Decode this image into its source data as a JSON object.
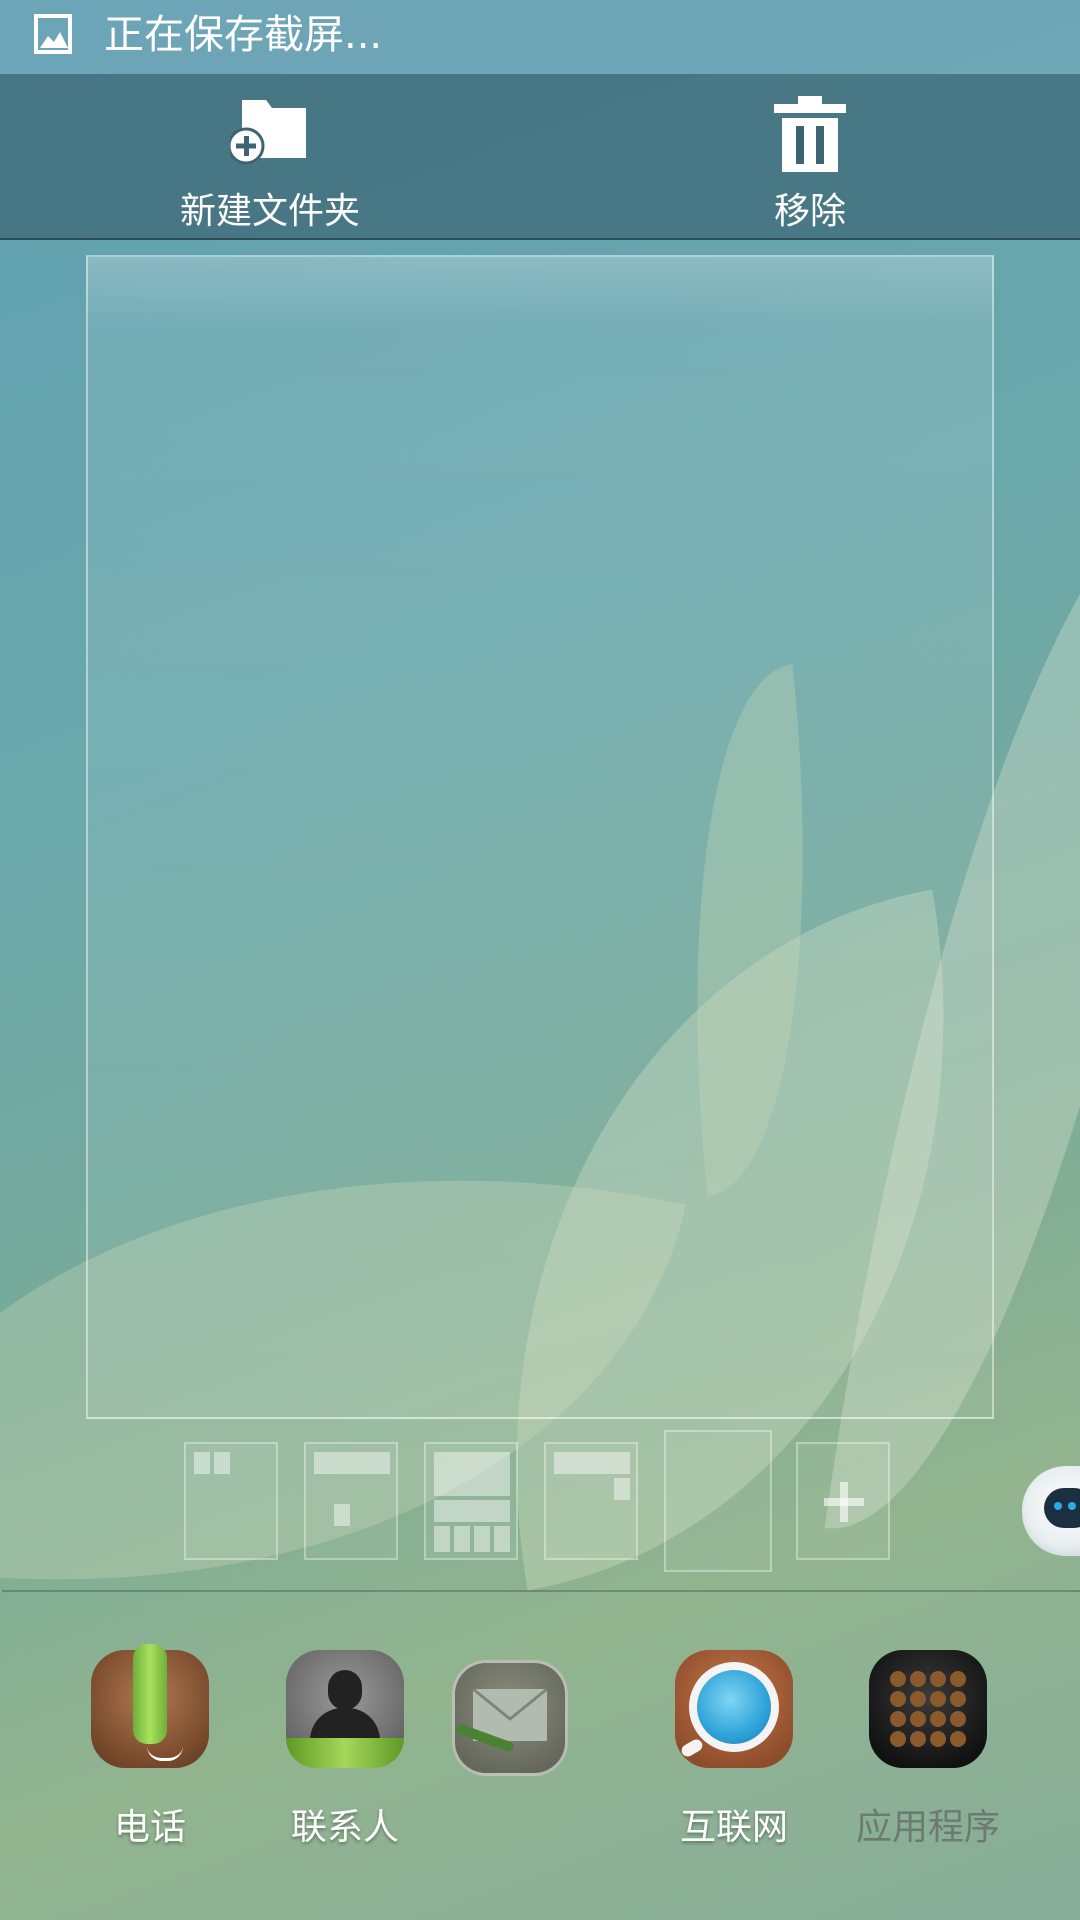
{
  "status_bar": {
    "text": "正在保存截屏..."
  },
  "action_bar": {
    "new_folder_label": "新建文件夹",
    "remove_label": "移除"
  },
  "layout_thumbnails": [
    {
      "icon": "two-small-widgets-layout"
    },
    {
      "icon": "wide-plus-small-layout"
    },
    {
      "icon": "grid-layout"
    },
    {
      "icon": "wide-with-corner-layout"
    },
    {
      "icon": "empty-layout"
    },
    {
      "icon": "add-layout"
    }
  ],
  "dock": {
    "apps": [
      {
        "label": "电话",
        "icon": "phone-icon"
      },
      {
        "label": "联系人",
        "icon": "contacts-icon"
      },
      {
        "label": "",
        "icon": "messages-icon"
      },
      {
        "label": "互联网",
        "icon": "internet-icon"
      },
      {
        "label": "应用程序",
        "icon": "apps-grid-icon"
      }
    ]
  },
  "colors": {
    "wallpaper_teal": "#5f9fb1",
    "wallpaper_green": "#92b48f",
    "action_bar": "#3c6473",
    "phone_green": "#8fd14f",
    "internet_blue": "#33a6d6"
  }
}
